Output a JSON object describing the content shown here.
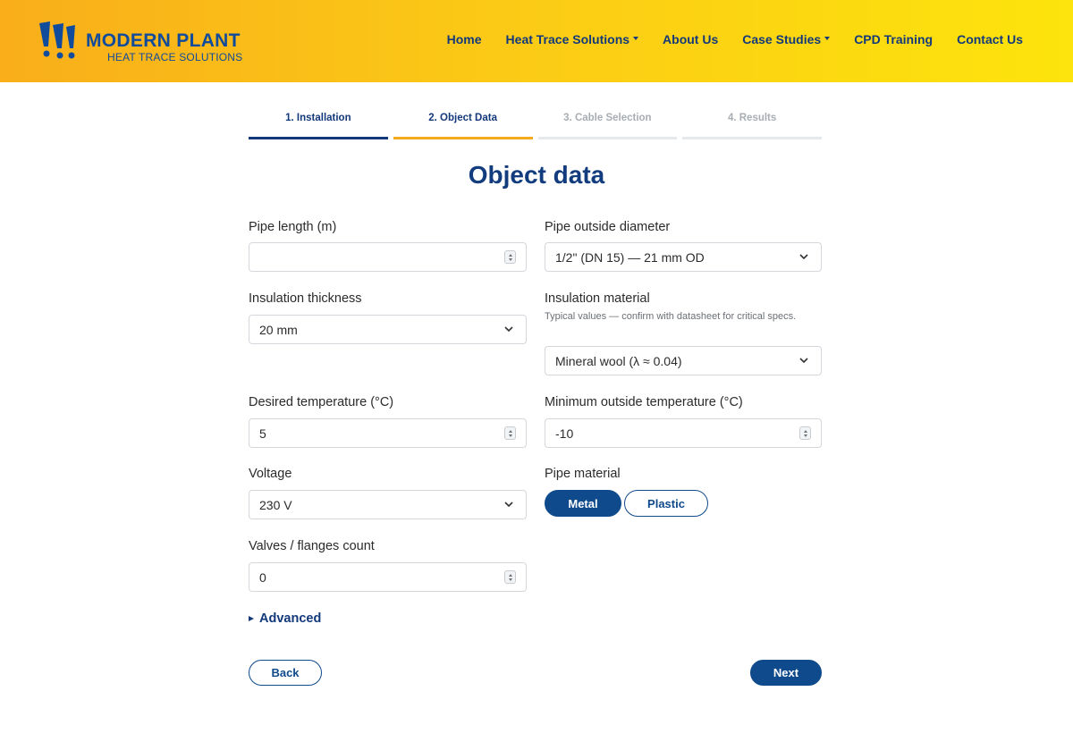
{
  "brand": {
    "name": "MODERN PLANT",
    "tagline": "HEAT TRACE SOLUTIONS",
    "primary_color": "#114b9b",
    "accent_color": "#f5ab1b"
  },
  "nav": {
    "items": [
      {
        "label": "Home",
        "dropdown": false
      },
      {
        "label": "Heat Trace Solutions",
        "dropdown": true
      },
      {
        "label": "About Us",
        "dropdown": false
      },
      {
        "label": "Case Studies",
        "dropdown": true
      },
      {
        "label": "CPD Training",
        "dropdown": false
      },
      {
        "label": "Contact Us",
        "dropdown": false
      }
    ]
  },
  "steps": [
    {
      "label": "1. Installation",
      "state": "done"
    },
    {
      "label": "2. Object Data",
      "state": "active"
    },
    {
      "label": "3. Cable Selection",
      "state": "todo"
    },
    {
      "label": "4. Results",
      "state": "todo"
    }
  ],
  "page_title": "Object data",
  "form": {
    "pipe_length": {
      "label": "Pipe length (m)",
      "value": ""
    },
    "pipe_diameter": {
      "label": "Pipe outside diameter",
      "value": "1/2\" (DN 15) — 21 mm OD"
    },
    "insulation_thickness": {
      "label": "Insulation thickness",
      "value": "20 mm"
    },
    "insulation_material": {
      "label": "Insulation material",
      "help": "Typical values — confirm with datasheet for critical specs.",
      "value": "Mineral wool (λ ≈ 0.04)"
    },
    "desired_temp": {
      "label": "Desired temperature (°C)",
      "value": "5"
    },
    "min_outside_temp": {
      "label": "Minimum outside temperature (°C)",
      "value": "-10"
    },
    "voltage": {
      "label": "Voltage",
      "value": "230 V"
    },
    "pipe_material": {
      "label": "Pipe material",
      "options": [
        "Metal",
        "Plastic"
      ],
      "selected": "Metal"
    },
    "valves_count": {
      "label": "Valves / flanges count",
      "value": "0"
    }
  },
  "advanced_label": "Advanced",
  "buttons": {
    "back": "Back",
    "next": "Next"
  }
}
